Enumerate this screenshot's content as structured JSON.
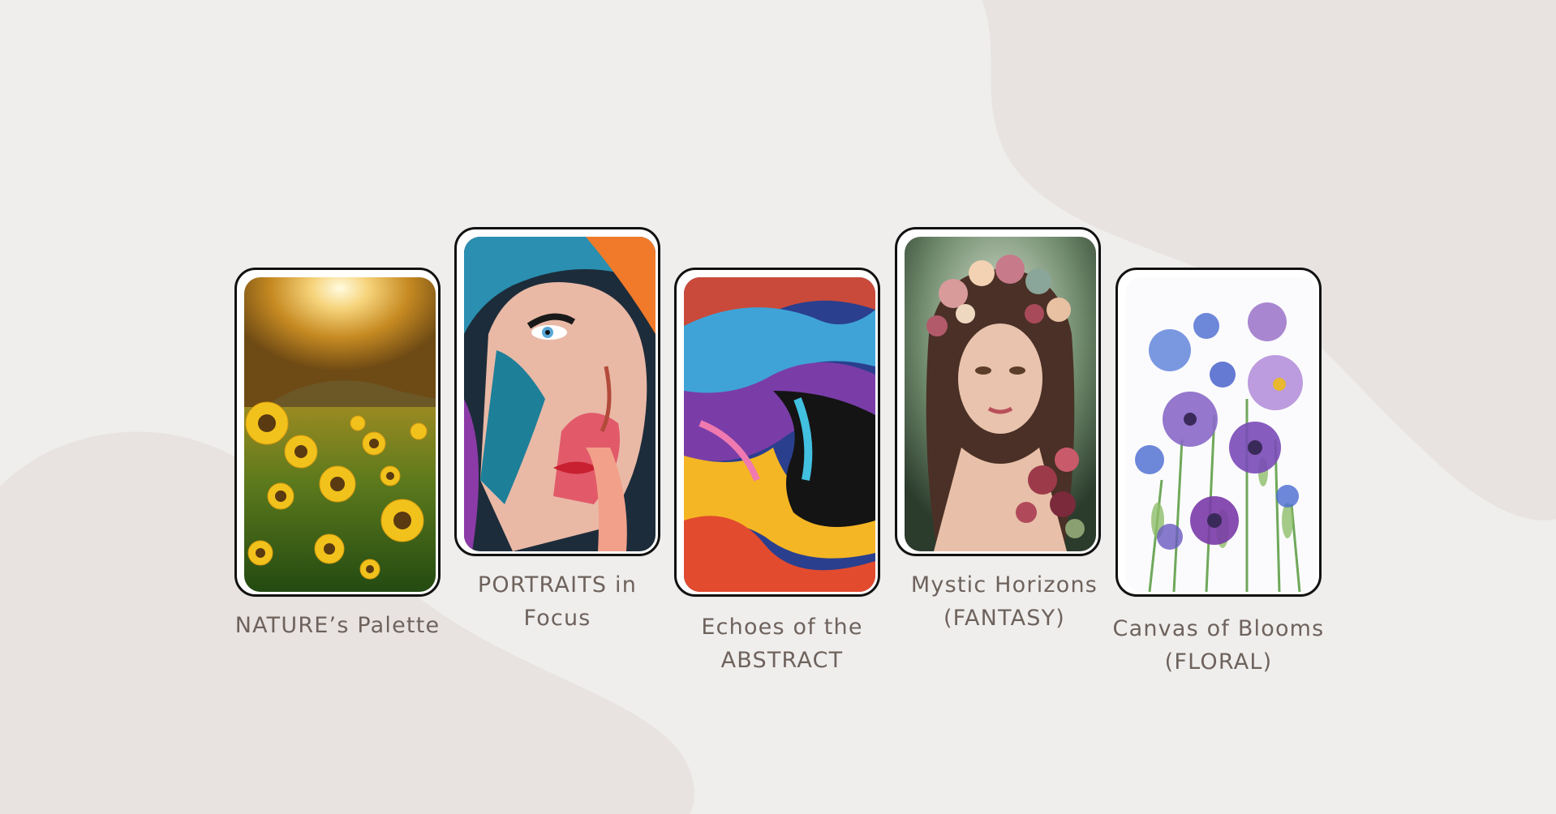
{
  "gallery": {
    "cards": [
      {
        "id": "nature",
        "caption": [
          "NATURE’s Palette"
        ],
        "artwork": "sunflower-field-painting"
      },
      {
        "id": "portraits",
        "caption": [
          "PORTRAITS in",
          "Focus"
        ],
        "artwork": "colorful-face-portrait-painting"
      },
      {
        "id": "abstract",
        "caption": [
          "Echoes of the",
          "ABSTRACT"
        ],
        "artwork": "abstract-swirl-profile-painting"
      },
      {
        "id": "fantasy",
        "caption": [
          "Mystic Horizons",
          "(FANTASY)"
        ],
        "artwork": "fantasy-woman-flower-crown-painting"
      },
      {
        "id": "floral",
        "caption": [
          "Canvas of Blooms",
          "(FLORAL)"
        ],
        "artwork": "watercolor-purple-flowers-painting"
      }
    ]
  },
  "colors": {
    "background": "#efeeed",
    "background_shape": "#e8e3e1",
    "caption_text": "#6e625c",
    "frame_border": "#111111"
  }
}
